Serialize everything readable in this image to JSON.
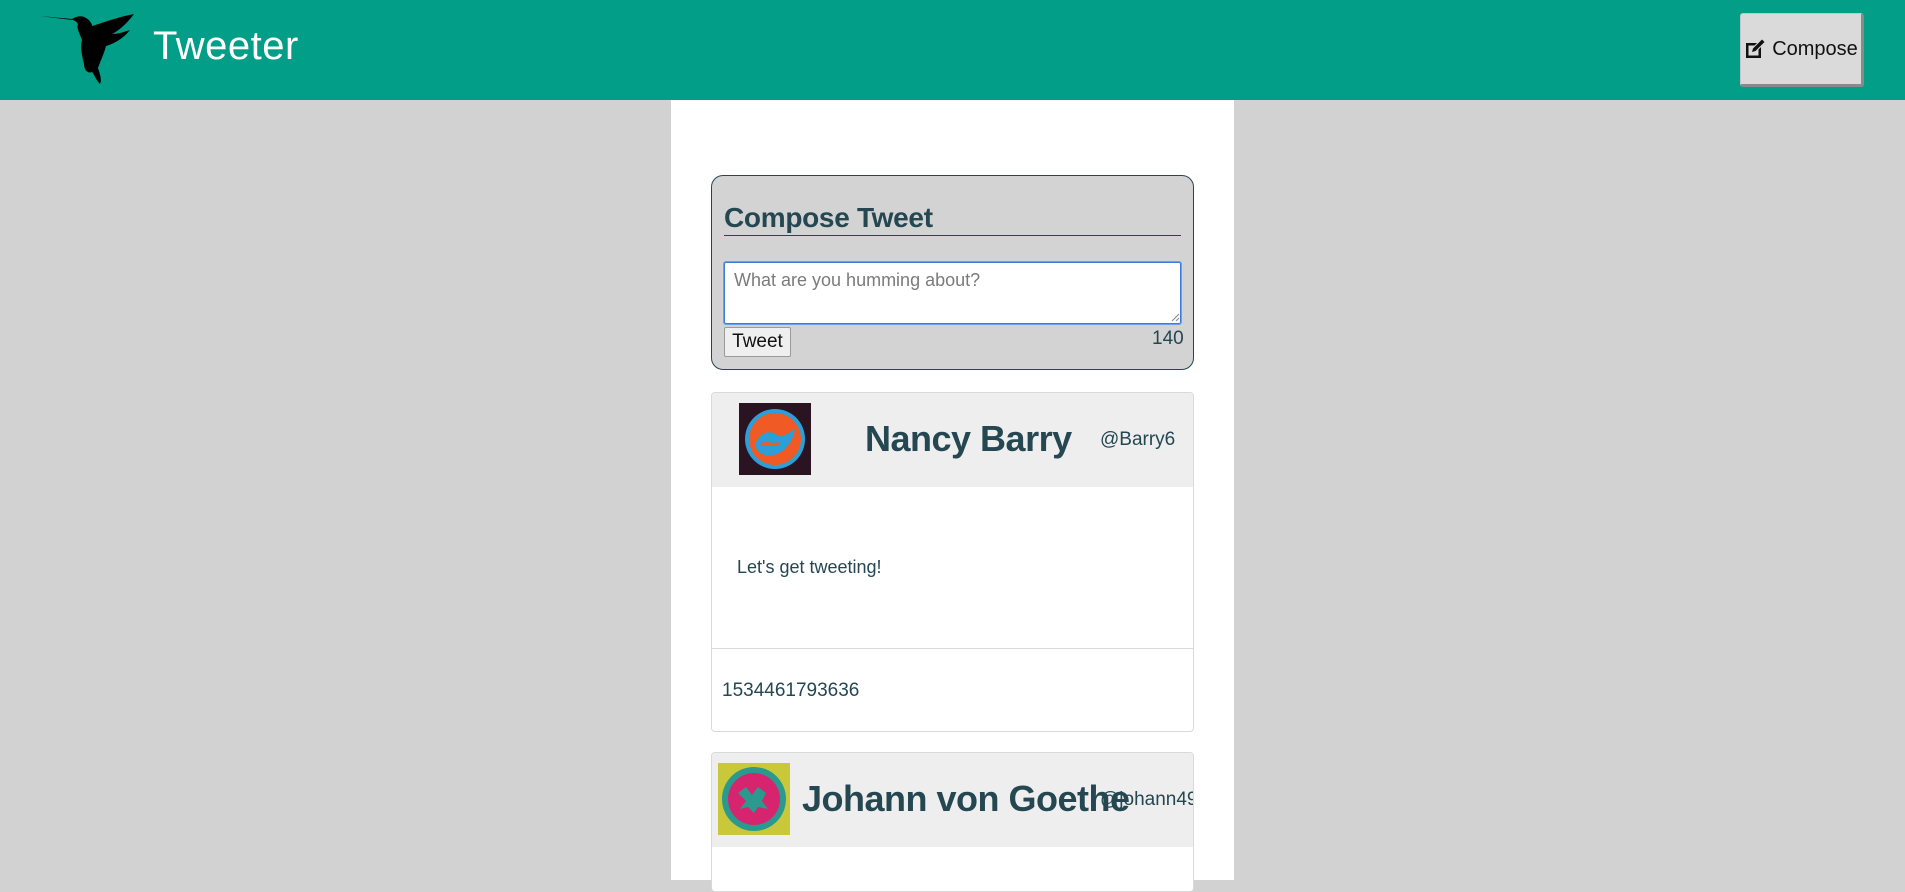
{
  "nav": {
    "brand": "Tweeter",
    "compose_label": "Compose"
  },
  "compose": {
    "title": "Compose Tweet",
    "placeholder": "What are you humming about?",
    "tweet_button": "Tweet",
    "char_count": "140"
  },
  "tweets": [
    {
      "name": "Nancy Barry",
      "handle": "@Barry6",
      "text": "Let's get tweeting!",
      "timestamp": "1534461793636"
    },
    {
      "name": "Johann von Goethe",
      "handle": "@johann49"
    }
  ],
  "icons": {
    "logo": "hummingbird-icon",
    "compose": "edit-icon"
  },
  "colors": {
    "navbar": "#039e87",
    "background": "#d2d2d3",
    "text": "#244751"
  }
}
